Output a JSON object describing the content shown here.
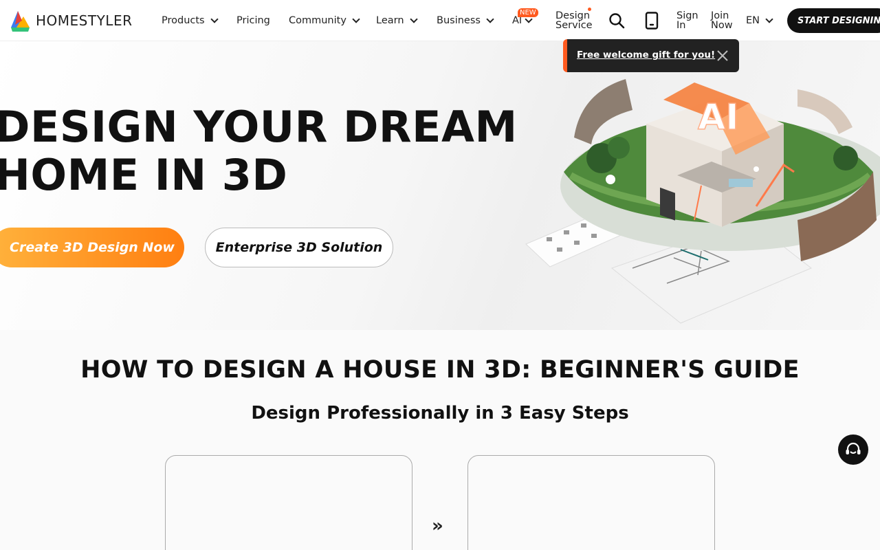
{
  "brand": {
    "name": "HOMESTYLER"
  },
  "nav": {
    "products": "Products",
    "pricing": "Pricing",
    "community": "Community",
    "learn": "Learn",
    "business": "Business",
    "ai": "AI",
    "ai_badge": "NEW",
    "design_service_line1": "Design",
    "design_service_line2": "Service",
    "sign_in_line1": "Sign",
    "sign_in_line2": "In",
    "join_now_line1": "Join",
    "join_now_line2": "Now",
    "language": "EN",
    "start_designing": "START DESIGNING"
  },
  "gift_tooltip": {
    "text": "Free welcome gift for you!"
  },
  "hero": {
    "title_line1": "DESIGN YOUR DREAM",
    "title_line2": "HOME IN 3D",
    "primary_button": "Create 3D Design Now",
    "secondary_button": "Enterprise 3D Solution",
    "illustration_sign": "AI"
  },
  "guide": {
    "title": "HOW TO DESIGN A HOUSE IN 3D: BEGINNER'S GUIDE",
    "subtitle": "Design Professionally in 3 Easy Steps",
    "arrow": "»"
  },
  "colors": {
    "accent": "#ff7f11",
    "accent_light": "#ffb23c",
    "badge": "#ff5a1f",
    "dark": "#111111"
  },
  "icons": {
    "search": "search-icon",
    "mobile": "mobile-icon",
    "close": "close-icon",
    "support": "headset-icon"
  }
}
